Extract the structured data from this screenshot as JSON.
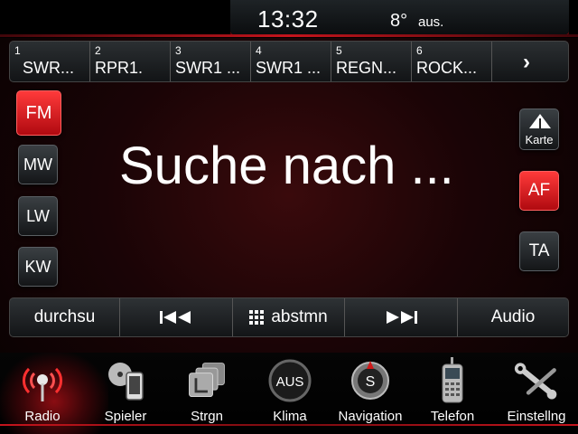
{
  "status": {
    "clock": "13:32",
    "temperature": "8°",
    "temperature_status": "aus."
  },
  "presets": [
    {
      "num": "1",
      "label": "SWR..."
    },
    {
      "num": "2",
      "label": "RPR1."
    },
    {
      "num": "3",
      "label": "SWR1 ..."
    },
    {
      "num": "4",
      "label": "SWR1 ..."
    },
    {
      "num": "5",
      "label": "REGN..."
    },
    {
      "num": "6",
      "label": "ROCK..."
    }
  ],
  "preset_next_icon": "chevron-right-icon",
  "bands": {
    "fm": "FM",
    "mw": "MW",
    "lw": "LW",
    "kw": "KW",
    "active": "FM"
  },
  "right_buttons": {
    "map": "Karte",
    "af": "AF",
    "ta": "TA",
    "af_active": true
  },
  "main_text": "Suche nach ...",
  "controls": {
    "browse": "durchsu",
    "prev_icon": "seek-back-icon",
    "tune": "abstmn",
    "next_icon": "seek-forward-icon",
    "audio": "Audio"
  },
  "nav": {
    "radio": "Radio",
    "player": "Spieler",
    "controls": "Strgn",
    "climate": "Klima",
    "climate_icon_text": "AUS",
    "navigation": "Navigation",
    "phone": "Telefon",
    "settings": "Einstellng",
    "active": "Radio"
  },
  "colors": {
    "accent": "#c4141c",
    "active_button": "#e01e24",
    "background": "#1a0406"
  }
}
